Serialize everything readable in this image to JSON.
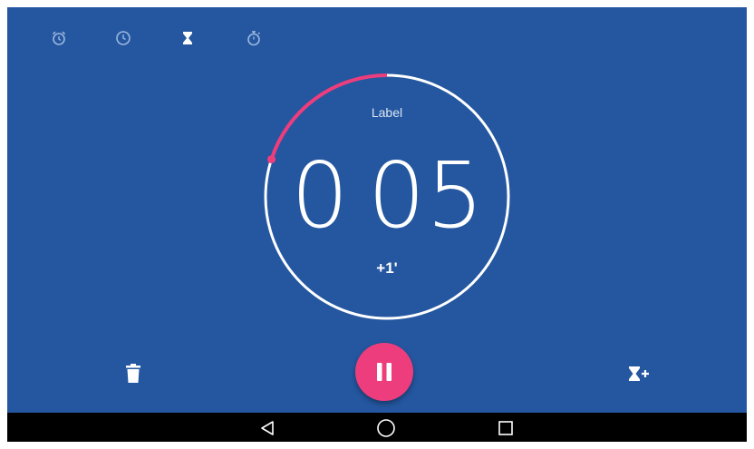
{
  "tabs": [
    {
      "icon": "alarm-icon",
      "active": false
    },
    {
      "icon": "clock-icon",
      "active": false
    },
    {
      "icon": "hourglass-icon",
      "active": true
    },
    {
      "icon": "stopwatch-icon",
      "active": false
    }
  ],
  "timer": {
    "label": "Label",
    "minutes": "0",
    "seconds": "05",
    "add_minute_label": "+1'",
    "remaining_fraction": 0.2
  },
  "controls": {
    "delete_icon": "trash-icon",
    "pause_icon": "pause-icon",
    "add_timer_icon": "hourglass-plus-icon"
  },
  "navigation": {
    "back_icon": "back-triangle-icon",
    "home_icon": "home-circle-icon",
    "recents_icon": "recents-square-icon"
  },
  "colors": {
    "background": "#2457a0",
    "ring": "#ffffff",
    "progress": "#ee3d7c",
    "fab": "#ee3d7c",
    "icon_inactive": "#9db7df",
    "icon_active": "#ffffff"
  }
}
